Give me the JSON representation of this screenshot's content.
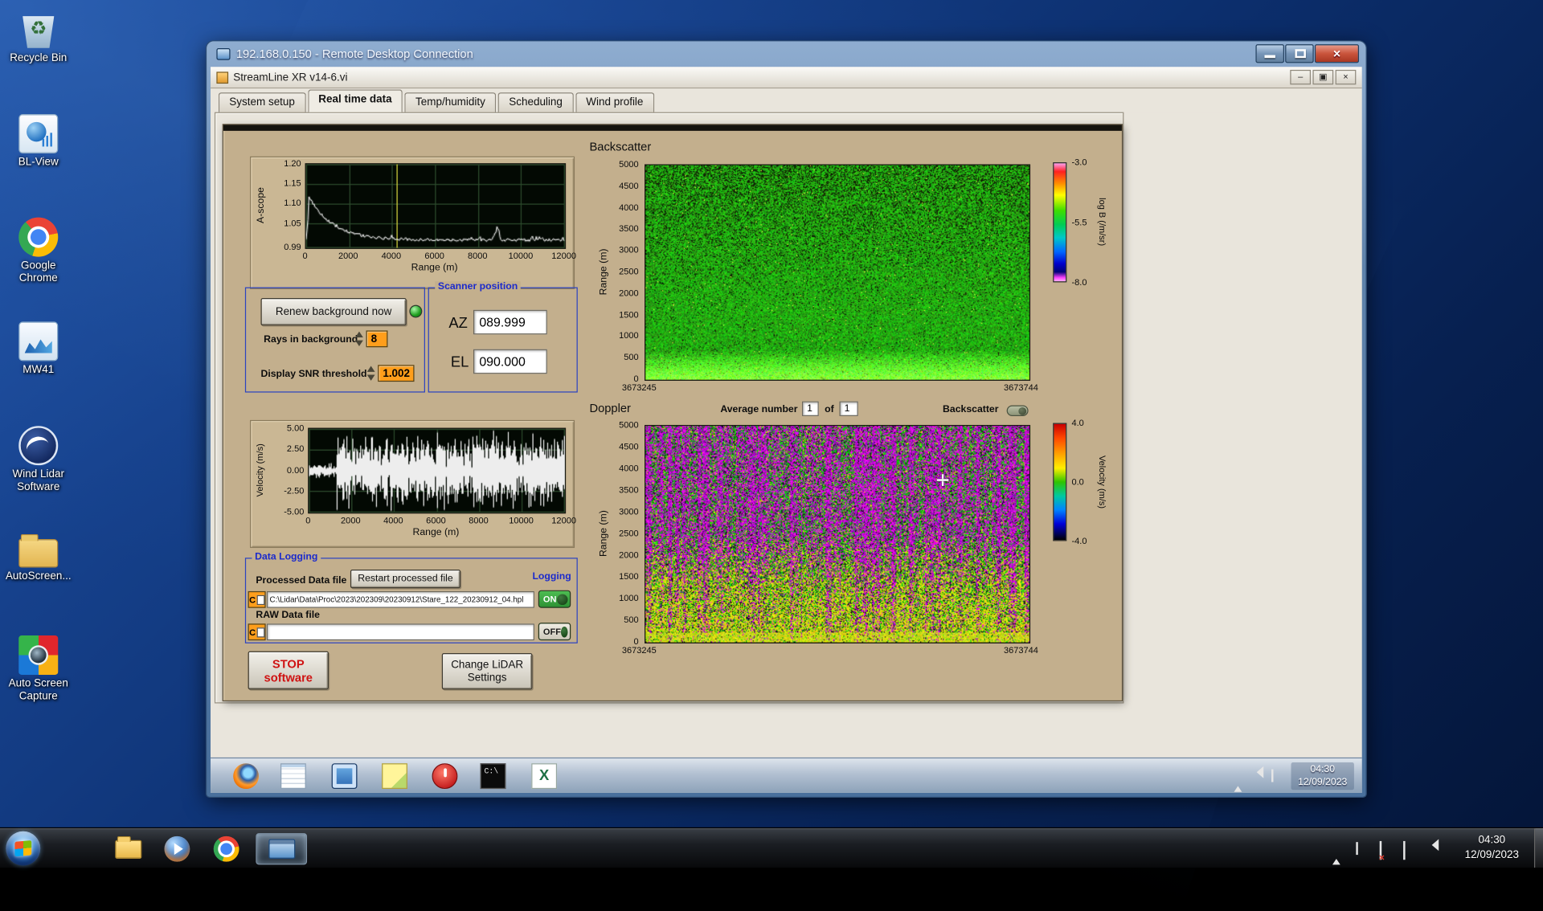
{
  "desktop": {
    "icons": [
      {
        "id": "recycle-bin",
        "label": "Recycle Bin"
      },
      {
        "id": "bl-view",
        "label": "BL-View"
      },
      {
        "id": "chrome",
        "label": "Google Chrome"
      },
      {
        "id": "mw41",
        "label": "MW41"
      },
      {
        "id": "wind-lidar",
        "label": "Wind Lidar Software"
      },
      {
        "id": "autoscreen",
        "label": "AutoScreen..."
      },
      {
        "id": "auto-screen-capture",
        "label": "Auto Screen Capture"
      }
    ]
  },
  "rdp": {
    "title": "192.168.0.150 - Remote Desktop Connection"
  },
  "app": {
    "title": "StreamLine XR v14-6.vi",
    "tabs": [
      {
        "label": "System setup",
        "active": false
      },
      {
        "label": "Real time data",
        "active": true
      },
      {
        "label": "Temp/humidity",
        "active": false
      },
      {
        "label": "Scheduling",
        "active": false
      },
      {
        "label": "Wind profile",
        "active": false
      }
    ]
  },
  "controls": {
    "renew_button": "Renew background now",
    "rays_label": "Rays in background",
    "rays_value": "8",
    "snr_label": "Display SNR threshold",
    "snr_value": "1.002",
    "scanner": {
      "title": "Scanner position",
      "az_label": "AZ",
      "az_value": "089.999",
      "el_label": "EL",
      "el_value": "090.000"
    }
  },
  "plots": {
    "ascope": {
      "ylabel": "A-scope",
      "yticks": [
        "1.20",
        "1.15",
        "1.10",
        "1.05",
        "0.99"
      ],
      "xticks": [
        "0",
        "2000",
        "4000",
        "6000",
        "8000",
        "10000",
        "12000"
      ],
      "xlabel": "Range (m)"
    },
    "velocity": {
      "ylabel": "Velocity (m/s)",
      "yticks": [
        "5.00",
        "2.50",
        "0.00",
        "-2.50",
        "-5.00"
      ],
      "xticks": [
        "0",
        "2000",
        "4000",
        "6000",
        "8000",
        "10000",
        "12000"
      ],
      "xlabel": "Range (m)"
    },
    "backscatter": {
      "title": "Backscatter",
      "ylabel": "Range (m)",
      "yticks": [
        "5000",
        "4500",
        "4000",
        "3500",
        "3000",
        "2500",
        "2000",
        "1500",
        "1000",
        "500",
        "0"
      ],
      "xtick_left": "3673245",
      "xtick_right": "3673744",
      "colorbar": {
        "label": "log B (/m/sr)",
        "ticks": [
          "-3.0",
          "-5.5",
          "-8.0"
        ]
      }
    },
    "doppler": {
      "title": "Doppler",
      "ylabel": "Range (m)",
      "yticks": [
        "5000",
        "4500",
        "4000",
        "3500",
        "3000",
        "2500",
        "2000",
        "1500",
        "1000",
        "500",
        "0"
      ],
      "xtick_left": "3673245",
      "xtick_right": "3673744",
      "colorbar": {
        "label": "Velocity (m/s)",
        "ticks": [
          "4.0",
          "0.0",
          "-4.0"
        ]
      }
    }
  },
  "doppler_header": {
    "average_label": "Average number",
    "average_value": "1",
    "of_label": "of",
    "of_count": "1",
    "backscatter_label": "Backscatter"
  },
  "logging": {
    "group_title": "Data Logging",
    "processed_label": "Processed Data file",
    "restart_button": "Restart processed file",
    "logging_label": "Logging",
    "drive_letter": "C",
    "processed_path": "C:\\Lidar\\Data\\Proc\\2023\\202309\\20230912\\Stare_122_20230912_04.hpl",
    "raw_label": "RAW Data file",
    "raw_path": "",
    "on_label": "ON",
    "off_label": "OFF"
  },
  "actions": {
    "stop_line1": "STOP",
    "stop_line2": "software",
    "settings_line1": "Change LiDAR",
    "settings_line2": "Settings"
  },
  "inner_taskbar": {
    "items": [
      "firefox",
      "notepad",
      "monitor",
      "notes",
      "power",
      "cmd",
      "excel"
    ],
    "tray": [
      "arrow",
      "volume",
      "flag"
    ],
    "time": "04:30",
    "date": "12/09/2023"
  },
  "taskbar": {
    "buttons": [
      "ie",
      "explorer",
      "wmp",
      "chrome",
      "rdp"
    ],
    "tray": [
      "arrow",
      "flag",
      "network",
      "display",
      "volume"
    ],
    "time": "04:30",
    "date": "12/09/2023"
  },
  "colors": {
    "panel_tan": "#c3af8d",
    "label_blue": "#1b2acc",
    "value_orange": "#ff9e1b",
    "led_green": "#2fae2f"
  }
}
